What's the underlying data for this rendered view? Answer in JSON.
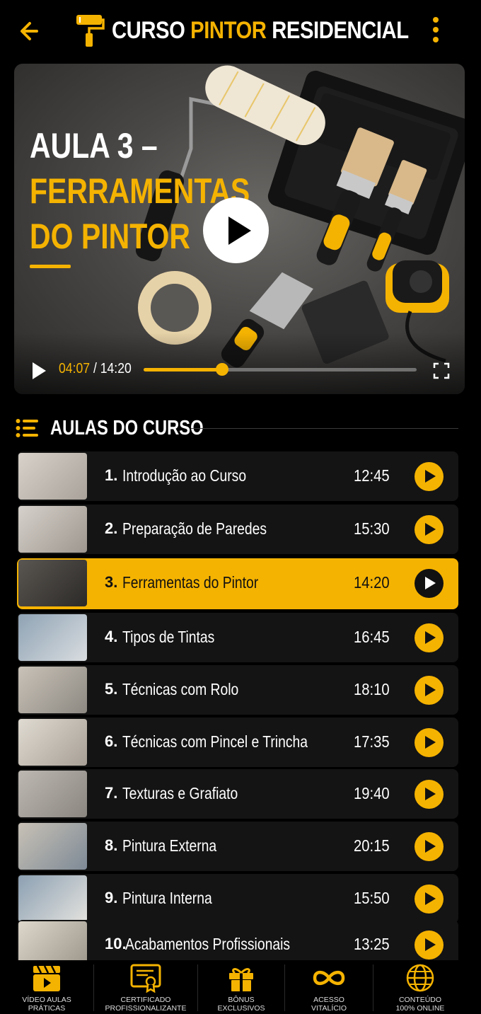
{
  "header": {
    "title_part1": "CURSO ",
    "title_accent": "PINTOR",
    "title_part2": " RESIDENCIAL"
  },
  "video": {
    "title_line1": "AULA 3 –",
    "title_line2": "FERRAMENTAS",
    "title_line3": "DO PINTOR",
    "current_time": "04:07",
    "separator": " / ",
    "total_time": "14:20",
    "progress_fraction": 0.287
  },
  "section": {
    "title": "AULAS DO CURSO"
  },
  "lessons": [
    {
      "num": "1.",
      "name": "Introdução ao Curso",
      "duration": "12:45"
    },
    {
      "num": "2.",
      "name": "Preparação de Paredes",
      "duration": "15:30"
    },
    {
      "num": "3.",
      "name": "Ferramentas do Pintor",
      "duration": "14:20",
      "active": true
    },
    {
      "num": "4.",
      "name": "Tipos de Tintas",
      "duration": "16:45"
    },
    {
      "num": "5.",
      "name": "Técnicas com Rolo",
      "duration": "18:10"
    },
    {
      "num": "6.",
      "name": "Técnicas com Pincel e Trincha",
      "duration": "17:35"
    },
    {
      "num": "7.",
      "name": "Texturas e Grafiato",
      "duration": "19:40"
    },
    {
      "num": "8.",
      "name": "Pintura Externa",
      "duration": "20:15"
    },
    {
      "num": "9.",
      "name": "Pintura Interna",
      "duration": "15:50"
    },
    {
      "num": "10.",
      "name": "Acabamentos Profissionais",
      "duration": "13:25"
    }
  ],
  "bottom_nav": [
    {
      "line1": "VÍDEO AULAS",
      "line2": "PRÁTICAS",
      "icon": "clapperboard-icon"
    },
    {
      "line1": "CERTIFICADO",
      "line2": "PROFISSIONALIZANTE",
      "icon": "certificate-icon"
    },
    {
      "line1": "BÔNUS",
      "line2": "EXCLUSIVOS",
      "icon": "gift-icon"
    },
    {
      "line1": "ACESSO",
      "line2": "VITALÍCIO",
      "icon": "infinity-icon"
    },
    {
      "line1": "CONTEÚDO",
      "line2": "100% ONLINE",
      "icon": "globe-icon"
    }
  ],
  "colors": {
    "accent": "#f5b301",
    "background": "#000000",
    "card": "#141414"
  }
}
